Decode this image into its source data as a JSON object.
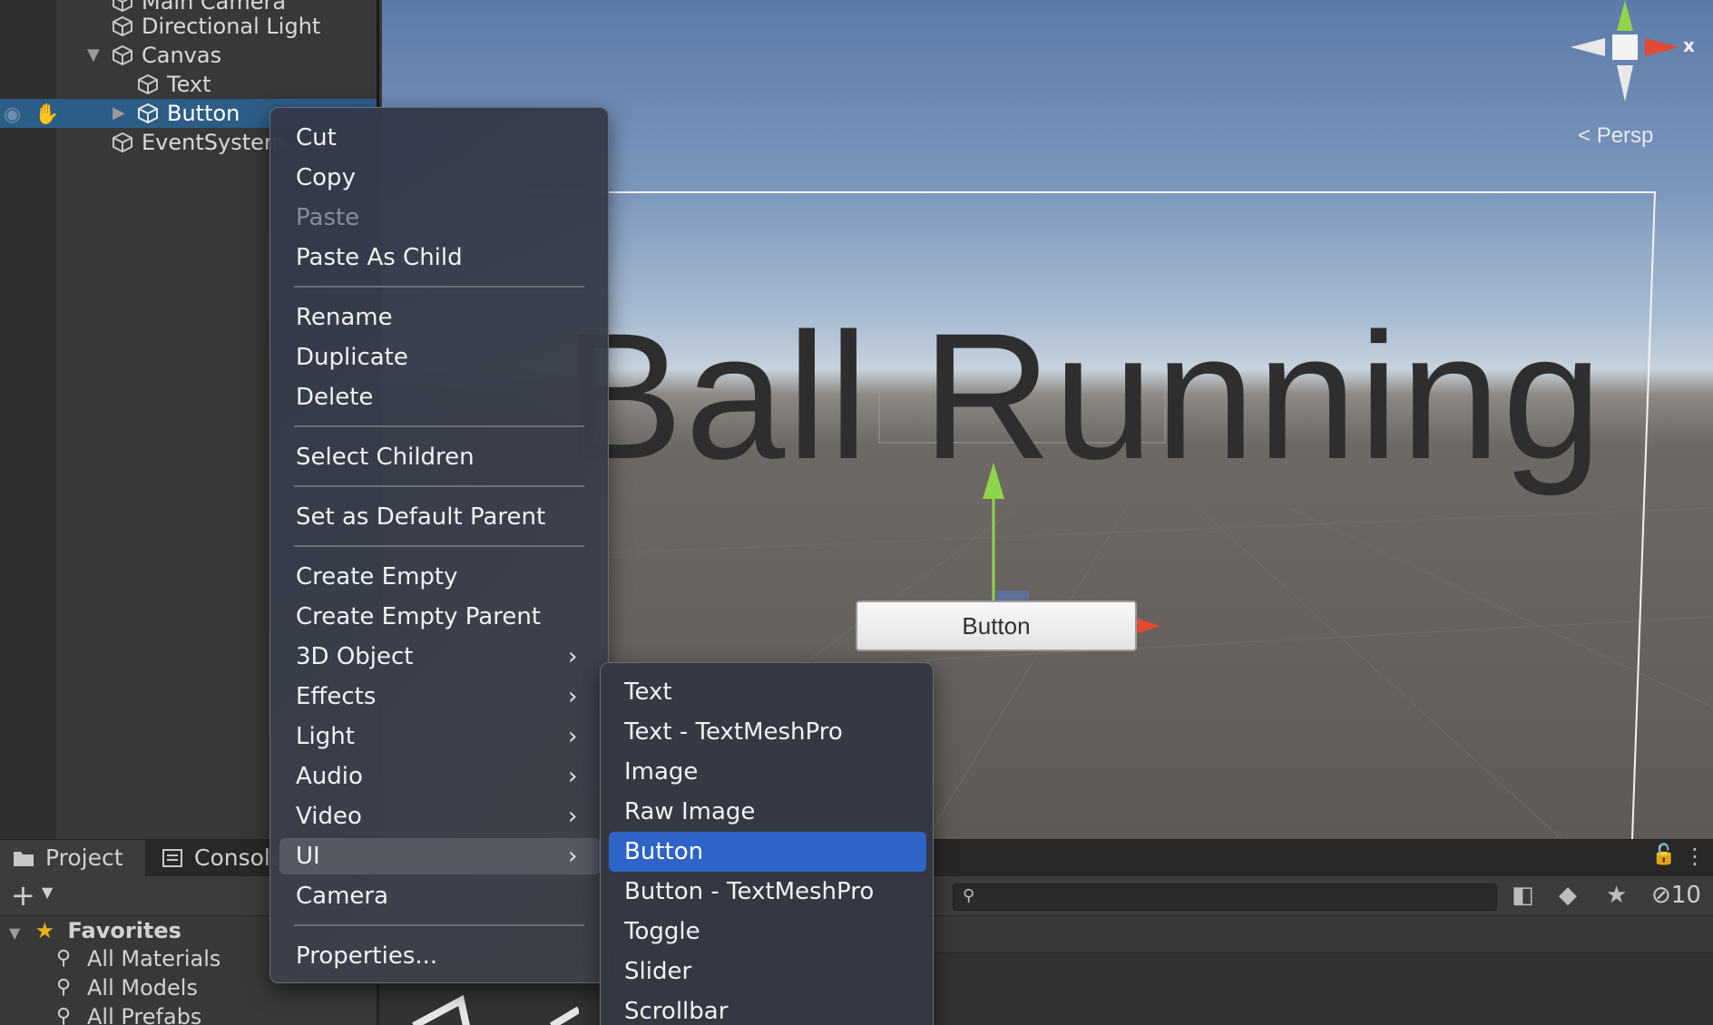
{
  "hierarchy": {
    "items": [
      {
        "label": "Main Camera"
      },
      {
        "label": "Directional Light"
      },
      {
        "label": "Canvas"
      },
      {
        "label": "Text"
      },
      {
        "label": "Button"
      },
      {
        "label": "EventSystem"
      }
    ]
  },
  "scene": {
    "title_text": "Ball Running",
    "button_text": "Button",
    "gizmo_x_label": "x",
    "persp_label": "Persp"
  },
  "context_menu": {
    "items": [
      "Cut",
      "Copy",
      "Paste",
      "Paste As Child",
      "Rename",
      "Duplicate",
      "Delete",
      "Select Children",
      "Set as Default Parent",
      "Create Empty",
      "Create Empty Parent",
      "3D Object",
      "Effects",
      "Light",
      "Audio",
      "Video",
      "UI",
      "Camera",
      "Properties..."
    ],
    "submenu_chevron": "›"
  },
  "ui_submenu": {
    "items": [
      "Text",
      "Text - TextMeshPro",
      "Image",
      "Raw Image",
      "Button",
      "Button - TextMeshPro",
      "Toggle",
      "Slider",
      "Scrollbar"
    ]
  },
  "project_panel": {
    "tabs": [
      "Project",
      "Console"
    ],
    "add_label": "+",
    "hidden_count": "10",
    "favorites": {
      "header": "Favorites",
      "items": [
        "All Materials",
        "All Models",
        "All Prefabs"
      ]
    }
  },
  "colors": {
    "selection": "#2c5d87",
    "menu_highlight": "#2e63c8",
    "gizmo_x": "#e04a36",
    "gizmo_y": "#8fd44a"
  }
}
